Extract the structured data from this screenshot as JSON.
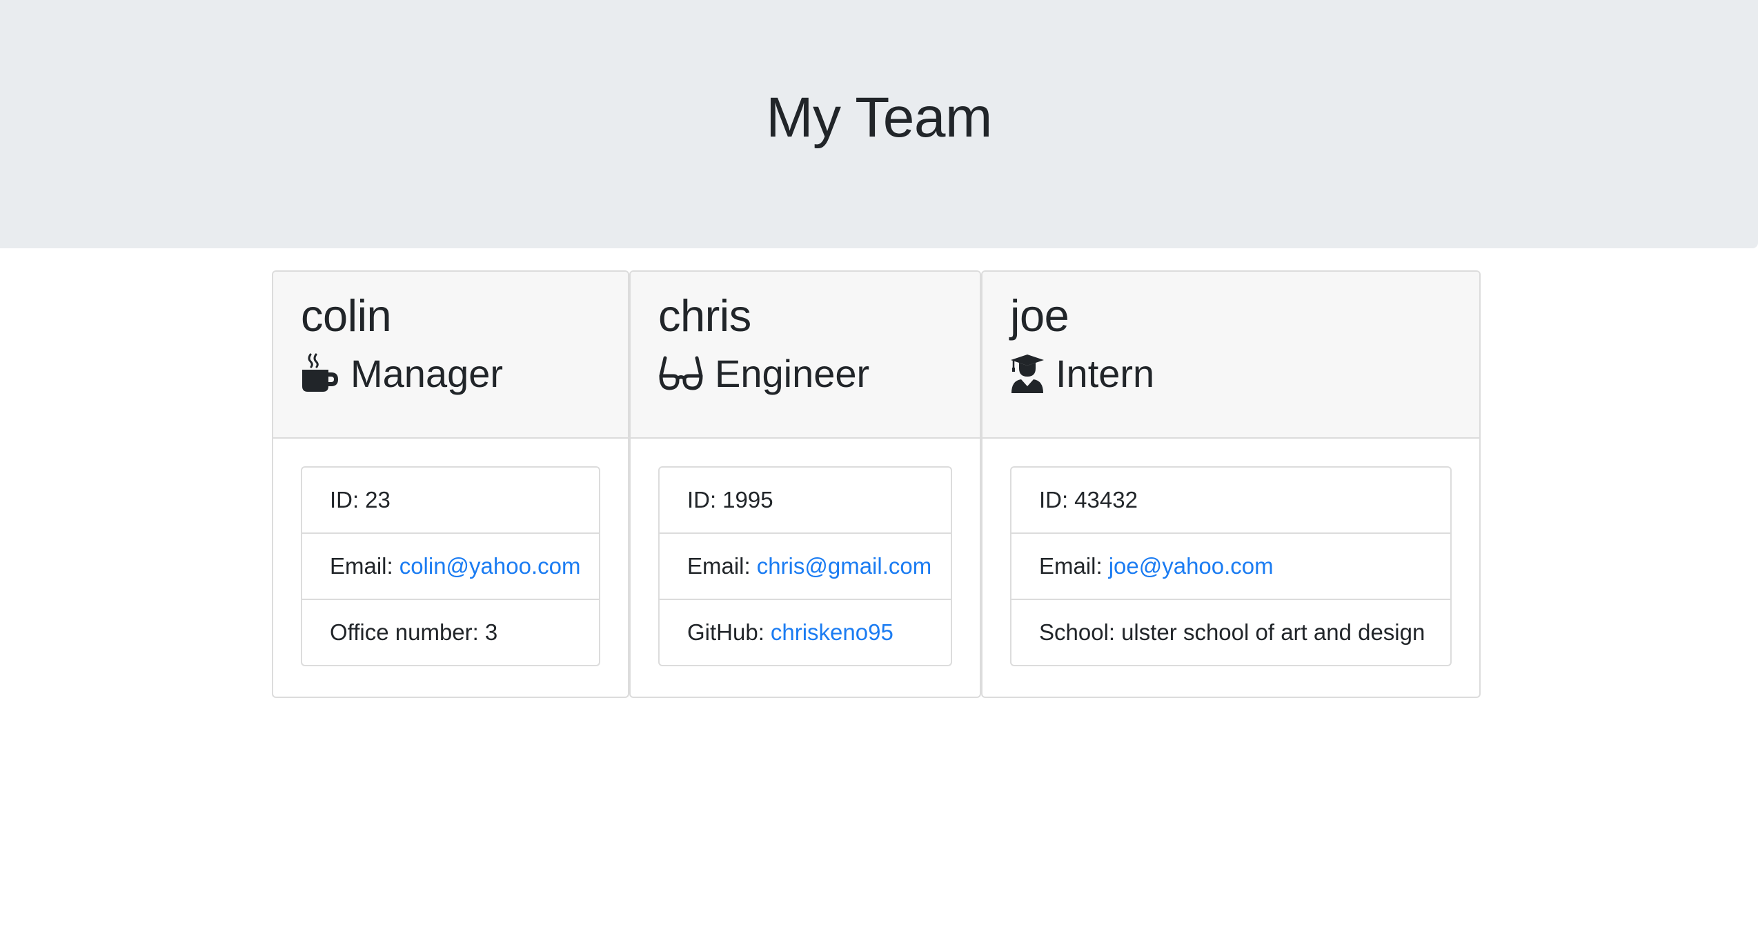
{
  "page": {
    "title": "My Team"
  },
  "colors": {
    "link": "#1b7cf2",
    "header_bg": "#e9ecef",
    "card_header_bg": "#f7f7f7"
  },
  "employees": [
    {
      "name": "colin",
      "role": "Manager",
      "icon": "mug-hot-icon",
      "id_label": "ID:",
      "id": "23",
      "email_label": "Email:",
      "email": "colin@yahoo.com",
      "extra_label": "Office number:",
      "extra": "3"
    },
    {
      "name": "chris",
      "role": "Engineer",
      "icon": "glasses-icon",
      "id_label": "ID:",
      "id": "1995",
      "email_label": "Email:",
      "email": "chris@gmail.com",
      "extra_label": "GitHub:",
      "extra": "chriskeno95"
    },
    {
      "name": "joe",
      "role": "Intern",
      "icon": "user-graduate-icon",
      "id_label": "ID:",
      "id": "43432",
      "email_label": "Email:",
      "email": "joe@yahoo.com",
      "extra_label": "School:",
      "extra": "ulster school of art and design"
    }
  ]
}
